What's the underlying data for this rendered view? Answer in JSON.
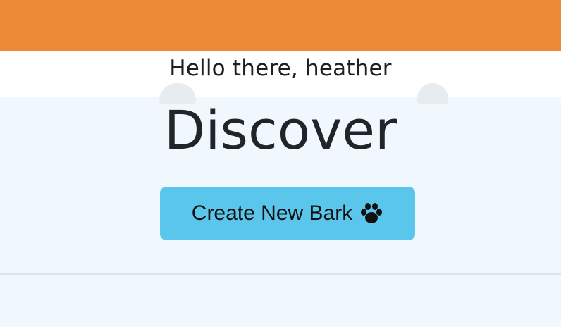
{
  "greeting": "Hello there, heather",
  "page_title": "Discover",
  "create_button": {
    "label": "Create New Bark",
    "icon": "paw-icon"
  },
  "colors": {
    "header": "#ec8a35",
    "accent_button": "#5bc6ec",
    "page_background": "#f0f7fd"
  }
}
